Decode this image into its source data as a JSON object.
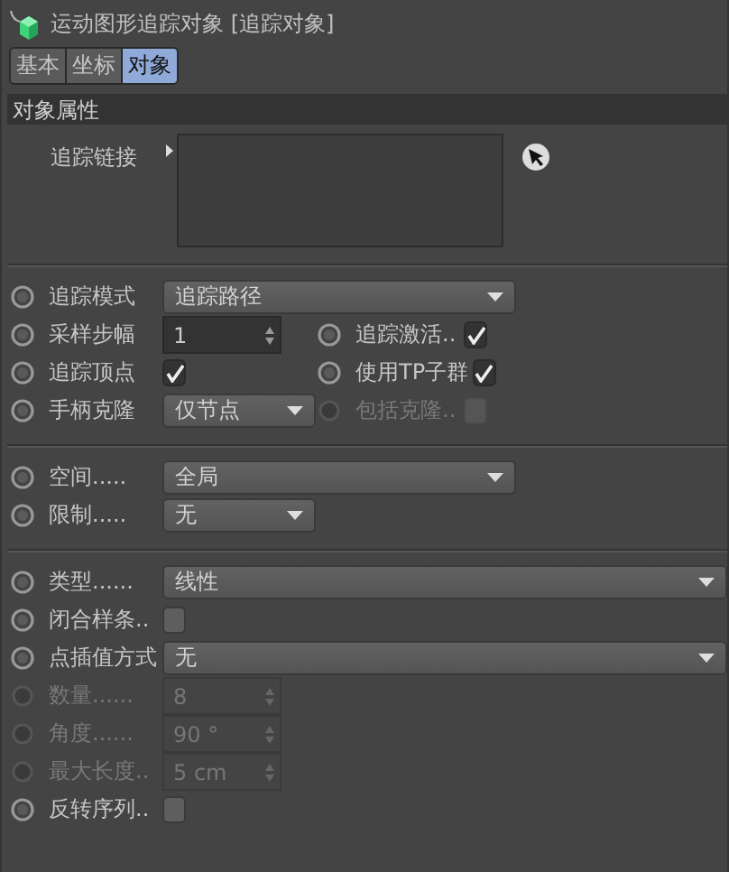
{
  "header": {
    "title": "运动图形追踪对象 [追踪对象]"
  },
  "tabs": [
    {
      "label": "基本",
      "selected": false
    },
    {
      "label": "坐标",
      "selected": false
    },
    {
      "label": "对象",
      "selected": true
    }
  ],
  "section": {
    "title": "对象属性"
  },
  "link_field": {
    "label": "追踪链接"
  },
  "groups": [
    {
      "rows": [
        {
          "label": "追踪模式",
          "disabled": false,
          "control": {
            "kind": "dropdown",
            "value": "追踪路径"
          }
        },
        {
          "label": "采样步幅",
          "disabled": false,
          "control": {
            "kind": "number",
            "value": "1"
          },
          "side": {
            "label": "追踪激活..",
            "disabled": false,
            "control": {
              "kind": "checkbox",
              "checked": true
            }
          }
        },
        {
          "label": "追踪顶点",
          "disabled": false,
          "control": {
            "kind": "checkbox",
            "checked": true
          },
          "side": {
            "label": "使用TP子群",
            "disabled": false,
            "control": {
              "kind": "checkbox",
              "checked": true
            }
          }
        },
        {
          "label": "手柄克隆",
          "disabled": false,
          "control": {
            "kind": "short-dropdown",
            "value": "仅节点"
          },
          "side": {
            "label": "包括克隆..",
            "disabled": true,
            "control": {
              "kind": "checkbox",
              "checked": false
            }
          }
        }
      ]
    },
    {
      "rows": [
        {
          "label": "空间.....",
          "disabled": false,
          "control": {
            "kind": "dropdown",
            "value": "全局"
          }
        },
        {
          "label": "限制.....",
          "disabled": false,
          "control": {
            "kind": "short-dropdown",
            "value": "无"
          }
        }
      ]
    },
    {
      "rows": [
        {
          "label": "类型......",
          "disabled": false,
          "control": {
            "kind": "dropdown",
            "value": "线性"
          }
        },
        {
          "label": "闭合样条..",
          "disabled": false,
          "control": {
            "kind": "checkbox",
            "checked": false
          }
        },
        {
          "label": "点插值方式",
          "disabled": false,
          "control": {
            "kind": "dropdown",
            "value": "无"
          }
        },
        {
          "label": "数量......",
          "disabled": true,
          "control": {
            "kind": "number",
            "value": "8"
          }
        },
        {
          "label": "角度......",
          "disabled": true,
          "control": {
            "kind": "number",
            "value": "90 °"
          }
        },
        {
          "label": "最大长度..",
          "disabled": true,
          "control": {
            "kind": "number",
            "value": "5 cm"
          }
        },
        {
          "label": "反转序列..",
          "disabled": false,
          "control": {
            "kind": "checkbox",
            "checked": false
          }
        }
      ]
    }
  ]
}
